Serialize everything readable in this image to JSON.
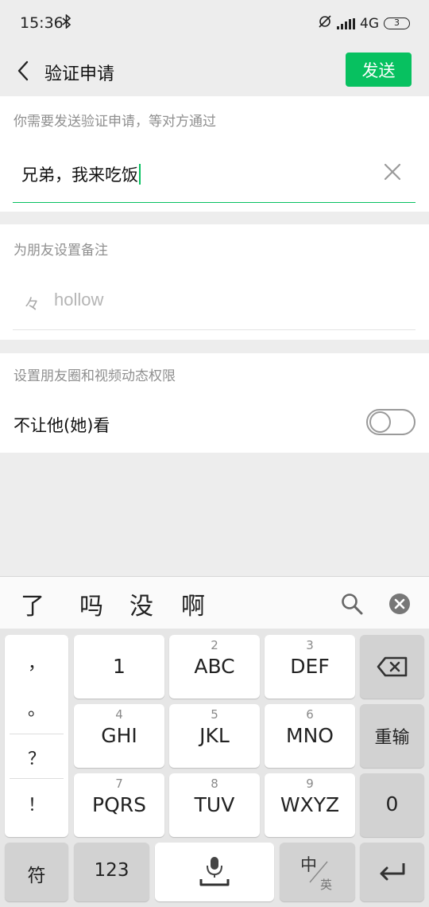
{
  "status": {
    "time": "15:36",
    "network": "4G",
    "battery": "3"
  },
  "nav": {
    "title": "验证申请",
    "send_label": "发送"
  },
  "request": {
    "label": "你需要发送验证申请，等对方通过",
    "value": "兄弟，我来吃饭"
  },
  "remark": {
    "label": "为朋友设置备注",
    "icon_glyph": "々",
    "value": "hollow"
  },
  "permissions": {
    "label": "设置朋友圈和视频动态权限",
    "toggle_label": "不让他(她)看",
    "toggle_on": false
  },
  "keyboard": {
    "candidates": [
      "了",
      "吗",
      "没",
      "啊"
    ],
    "punct": [
      "，",
      "。",
      "？",
      "！"
    ],
    "keys": [
      {
        "num": "",
        "letters": "1"
      },
      {
        "num": "2",
        "letters": "ABC"
      },
      {
        "num": "3",
        "letters": "DEF"
      },
      {
        "num": "4",
        "letters": "GHI"
      },
      {
        "num": "5",
        "letters": "JKL"
      },
      {
        "num": "6",
        "letters": "MNO"
      },
      {
        "num": "7",
        "letters": "PQRS"
      },
      {
        "num": "8",
        "letters": "TUV"
      },
      {
        "num": "9",
        "letters": "WXYZ"
      }
    ],
    "reenter_label": "重输",
    "zero_label": "0",
    "symbol_label": "符",
    "numeric_label": "123",
    "lang_main": "中",
    "lang_alt": "英"
  },
  "colors": {
    "accent": "#07c160",
    "background": "#ededed"
  }
}
